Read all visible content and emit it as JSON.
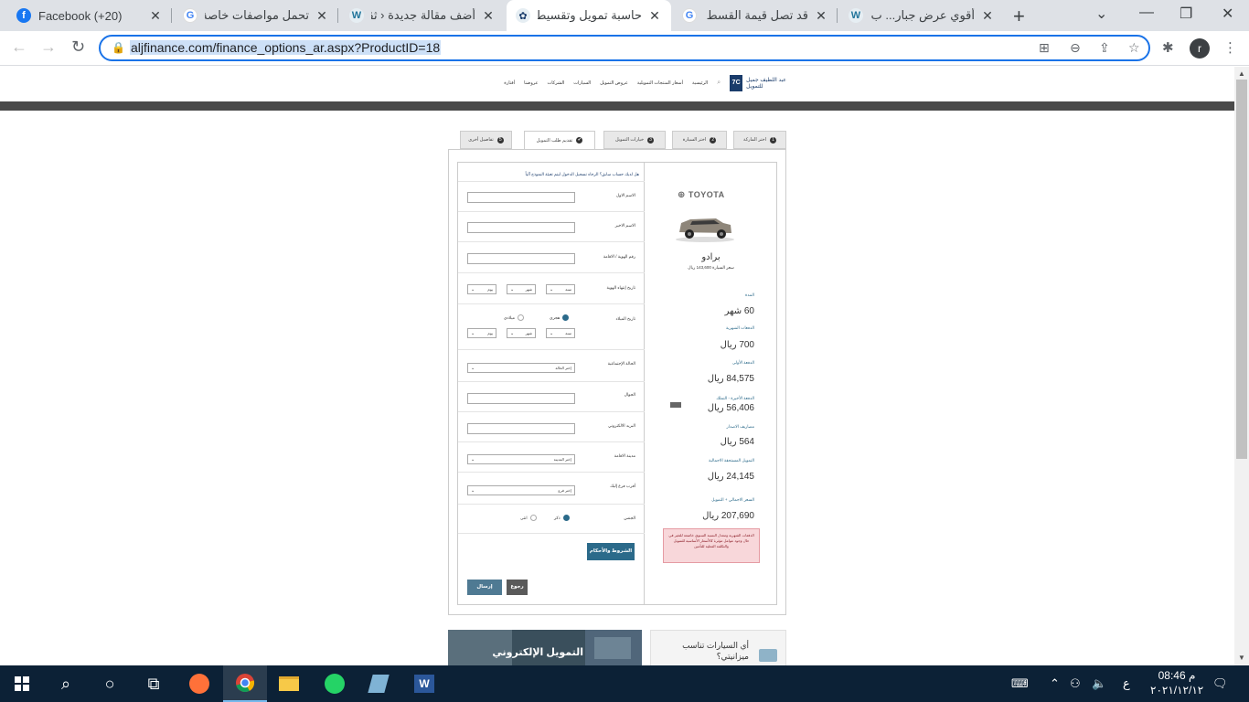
{
  "browser": {
    "tabs": [
      {
        "title": "Facebook (+20)",
        "icon": "facebook-icon",
        "color": "#1877f2",
        "active": false
      },
      {
        "title": "تحمل مواصفات خاصة",
        "icon": "google-icon",
        "color": "#4285f4",
        "active": false
      },
      {
        "title": "أضف مقالة جديدة ‹ ثقف",
        "icon": "wordpress-icon",
        "color": "#21759b",
        "active": false
      },
      {
        "title": "حاسبة تمويل وتقسيط ا",
        "icon": "abdullatif-jameel-icon",
        "color": "#1a3c6b",
        "active": true
      },
      {
        "title": "قد تصل قيمة القسط •",
        "icon": "google-icon",
        "color": "#4285f4",
        "active": false
      },
      {
        "title": "أقوي عرض جبار... ب 00",
        "icon": "wordpress-icon",
        "color": "#21759b",
        "active": false
      }
    ],
    "url": "aljfinance.com/finance_options_ar.aspx?ProductID=18",
    "profile_initial": "r"
  },
  "site": {
    "logo_text": "عبد اللطيف جميل",
    "logo_sub": "للتمويل",
    "nav": [
      "الرئيسية",
      "أسعار المنتجات التمويلية",
      "عروض التمويل",
      "السيارات",
      "الشركات",
      "عروضنا",
      "أفتارة"
    ]
  },
  "steps": [
    {
      "num": "1",
      "label": "اختر الماركة"
    },
    {
      "num": "2",
      "label": "اختر السيارة"
    },
    {
      "num": "3",
      "label": "خيارات التمويل"
    },
    {
      "num": "✔",
      "label": "تقديم طلب التمويل"
    },
    {
      "num": "5",
      "label": "تفاصيل أخرى"
    }
  ],
  "form": {
    "intro": "هل لديك حساب سابق؟ الرجاء تسجيل الدخول ليتم تعبئة النموذج آلياً",
    "first_name": "الاسم الاول",
    "last_name": "الاسم الاخير",
    "id_number": "رقم الهوية / الاقامة",
    "id_expiry": "تاريخ إنتهاء الهوية",
    "birth_date": "تاريخ الميلاد",
    "hijri": "هجري",
    "gregorian": "ميلادي",
    "day": "يوم",
    "month": "شهر",
    "year": "سنة",
    "marital_status": "الحالة الإجتماعية",
    "marital_value": "إختر الحالة",
    "mobile": "الجوال",
    "email": "البريد الالكتروني",
    "city": "مدينة الاقامة",
    "city_value": "إختر المدينة",
    "nearest_branch": "أقرب فرع إليك",
    "branch_value": "إختر فرع",
    "gender": "الجنس",
    "male": "ذكر",
    "female": "انثى",
    "terms_button": "الشروط والأحكام",
    "submit_button": "إرسال",
    "back_button": "رجوع"
  },
  "summary": {
    "brand": "TOYOTA",
    "model": "برادو",
    "cash_price": "سعر السيارة 143,600 ريال",
    "items": [
      {
        "label": "المدة",
        "value": "60 شهر"
      },
      {
        "label": "الدفعات الشهرية",
        "value": "700 ريال"
      },
      {
        "label": "الدفعة الأولى",
        "value": "84,575 ريال"
      },
      {
        "label": "الدفعة الأخيرة - التملك",
        "value": "56,406 ريال"
      },
      {
        "label": "مصاريف الاصدار",
        "value": "564 ريال"
      },
      {
        "label": "التمويل المستحقة الاجمالية",
        "value": "24,145 ريال"
      },
      {
        "label": "السعر الاجمالي + التمويل",
        "value": "207,690 ريال"
      }
    ],
    "note": "الدفعات الشهرية ومعدل النسبة السنوي خاضعة للتغير في حال وجود عوامل مؤثرة كالأسعار الأساسية للتمويل والتكلفة الفعلية للتأمين"
  },
  "promos": {
    "finance_online": "التمويل الإلكتروني",
    "which_cars": "أي السيارات تناسب ميزانيتي؟"
  },
  "taskbar": {
    "time": "08:46 م",
    "date": "٢٠٢١/١٢/١٢",
    "lang": "ع"
  }
}
